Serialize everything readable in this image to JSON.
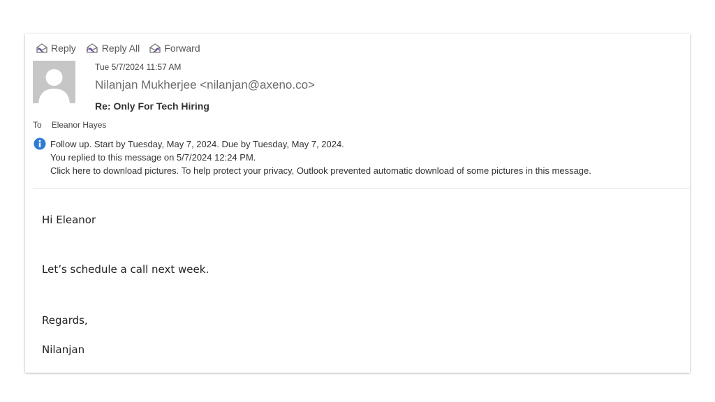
{
  "toolbar": {
    "reply_label": "Reply",
    "reply_all_label": "Reply All",
    "forward_label": "Forward"
  },
  "header": {
    "date": "Tue 5/7/2024 11:57 AM",
    "from": "Nilanjan Mukherjee <nilanjan@axeno.co>",
    "subject": "Re: Only For Tech Hiring",
    "to_label": "To",
    "to_value": "Eleanor Hayes"
  },
  "info": {
    "follow_up": "Follow up.  Start by Tuesday, May 7, 2024.  Due by Tuesday, May 7, 2024.",
    "replied": "You replied to this message on 5/7/2024 12:24 PM.",
    "pictures": "Click here to download pictures. To help protect your privacy, Outlook prevented automatic download of some pictures in this message."
  },
  "body": {
    "greeting": "Hi Eleanor",
    "line1": "Let’s schedule a call next week.",
    "closing": "Regards,",
    "signature": "Nilanjan"
  },
  "colors": {
    "info_icon": "#2f7bd3",
    "avatar_bg": "#c6c6c6",
    "icon_arrow": "#6b4fa0"
  }
}
